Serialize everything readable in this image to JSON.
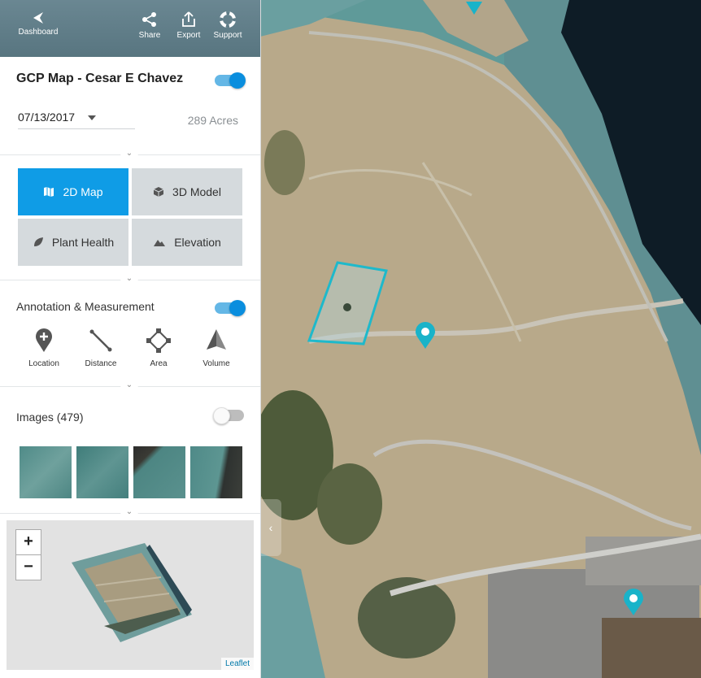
{
  "toolbar": {
    "dashboard_label": "Dashboard",
    "share_label": "Share",
    "export_label": "Export",
    "support_label": "Support"
  },
  "map_title": "GCP Map - Cesar E Chavez",
  "date": "07/13/2017",
  "acres": "289 Acres",
  "views": {
    "map2d": "2D Map",
    "model3d": "3D Model",
    "plant_health": "Plant Health",
    "elevation": "Elevation"
  },
  "annotation": {
    "label": "Annotation & Measurement",
    "tools": [
      "Location",
      "Distance",
      "Area",
      "Volume"
    ]
  },
  "images": {
    "label": "Images (479)"
  },
  "minimap": {
    "zoom_in": "+",
    "zoom_out": "−",
    "attribution": "Leaflet"
  },
  "colors": {
    "accent": "#0f9ce6",
    "topbar": "#5f7d88",
    "marker": "#19b3c9"
  }
}
